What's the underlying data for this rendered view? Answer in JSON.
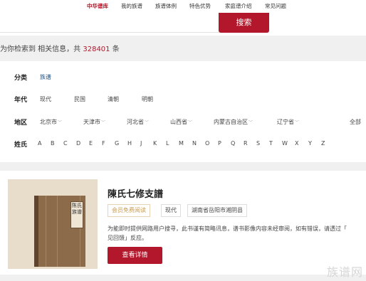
{
  "nav": {
    "items": [
      "中华谱库",
      "我的族谱",
      "族谱体例",
      "特色优势",
      "家庭谱介绍",
      "常见问题"
    ]
  },
  "search": {
    "button_label": "搜索"
  },
  "result": {
    "prefix": "为你检索到 相关信息，共 ",
    "count": "328401",
    "suffix": " 条"
  },
  "filters": {
    "category": {
      "label": "分类",
      "options": [
        "族谱"
      ]
    },
    "era": {
      "label": "年代",
      "options": [
        "现代",
        "民国",
        "清朝",
        "明朝"
      ]
    },
    "region": {
      "label": "地区",
      "options": [
        "北京市",
        "天津市",
        "河北省",
        "山西省",
        "内蒙古自治区",
        "辽宁省"
      ],
      "all": "全部"
    },
    "surname": {
      "label": "姓氏",
      "letters": [
        "A",
        "B",
        "C",
        "D",
        "E",
        "F",
        "G",
        "H",
        "J",
        "K",
        "L",
        "M",
        "N",
        "O",
        "P",
        "Q",
        "R",
        "S",
        "T",
        "W",
        "X",
        "Y",
        "Z"
      ]
    }
  },
  "card": {
    "title": "陳氏七修支譜",
    "cover_text": "陈氏族谱",
    "tags": [
      "会员免费阅读",
      "现代",
      "湖南省岳阳市湘阴县"
    ],
    "desc_line1": "为能即时提供网路用户搜寻，此书谨有简略讯息，谱书影像内容未经审阅，如有错误，请透过「",
    "desc_line2": "见回馈」反应。",
    "detail_button": "查看详情"
  },
  "watermark": "族谱网"
}
